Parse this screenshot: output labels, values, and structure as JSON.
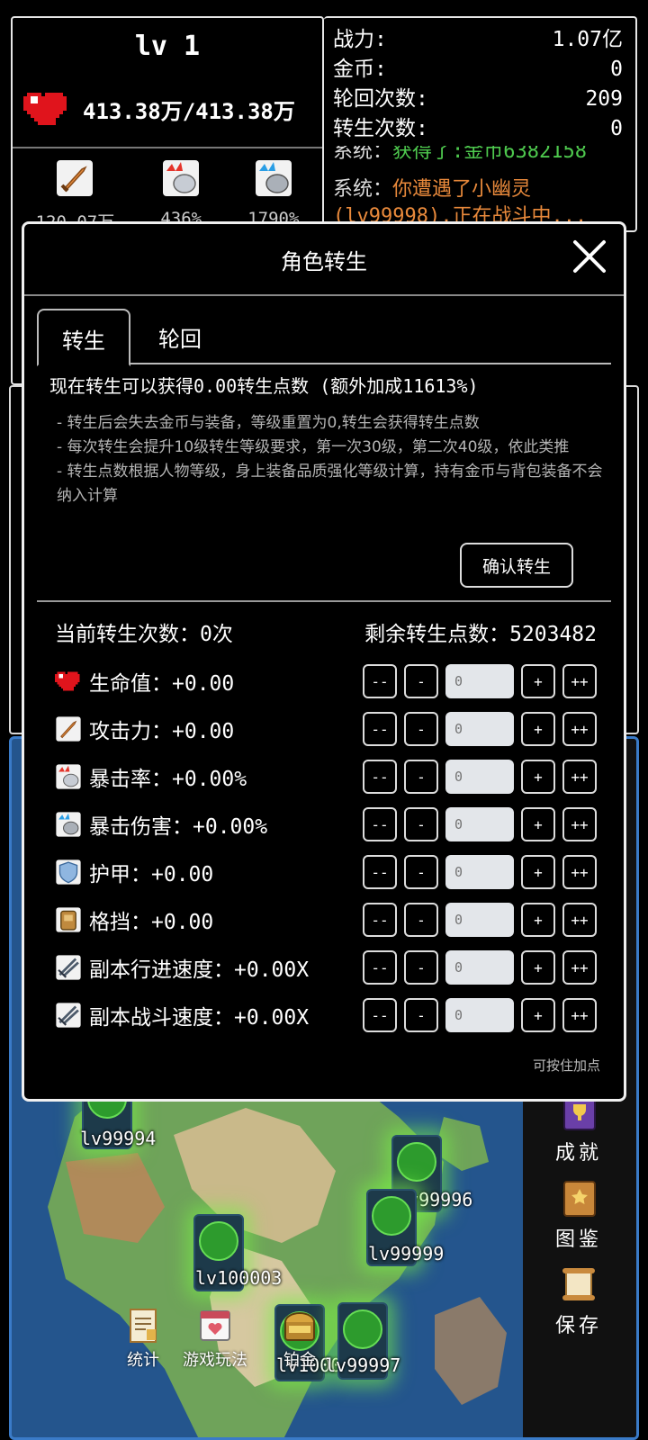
{
  "hud": {
    "level": "lv 1",
    "hp": "413.38万/413.38万",
    "stats": [
      {
        "icon": "sword-icon",
        "value": "120.07万"
      },
      {
        "icon": "crit-rate-icon",
        "value": "436%"
      },
      {
        "icon": "crit-damage-icon",
        "value": "1790%"
      }
    ]
  },
  "resources": [
    {
      "label": "战力:",
      "value": "1.07亿"
    },
    {
      "label": "金币:",
      "value": "0"
    },
    {
      "label": "轮回次数:",
      "value": "209"
    },
    {
      "label": "转生次数:",
      "value": "0"
    }
  ],
  "log": {
    "line1_prefix": "系统：",
    "line1_text": "获得了:金币6382158",
    "line2_prefix": "系统：",
    "line2_text": "你遭遇了小幽灵",
    "line3_text": "(lv99998),正在战斗中..."
  },
  "modal": {
    "title": "角色转生",
    "tabs": [
      "转生",
      "轮回"
    ],
    "gain_text": "现在转生可以获得0.00转生点数 (额外加成11613%)",
    "notes": [
      "- 转生后会失去金币与装备，等级重置为0,转生会获得转生点数",
      "- 每次转生会提升10级转生等级要求，第一次30级，第二次40级，依此类推",
      "- 转生点数根据人物等级，身上装备品质强化等级计算，持有金币与背包装备不会纳入计算"
    ],
    "confirm_label": "确认转生",
    "current_count": "当前转生次数：0次",
    "remaining_points": "剩余转生点数：5203482",
    "controls": {
      "dec_big": "--",
      "dec": "-",
      "inc": "+",
      "inc_big": "++"
    },
    "attributes": [
      {
        "icon": "heart-icon",
        "label": "生命值：+0.00",
        "input": "0"
      },
      {
        "icon": "sword-icon",
        "label": "攻击力：+0.00",
        "input": "0"
      },
      {
        "icon": "crit-rate-icon",
        "label": "暴击率：+0.00%",
        "input": "0"
      },
      {
        "icon": "crit-damage-icon",
        "label": "暴击伤害：+0.00%",
        "input": "0"
      },
      {
        "icon": "shield-icon",
        "label": "护甲：+0.00",
        "input": "0"
      },
      {
        "icon": "block-icon",
        "label": "格挡：+0.00",
        "input": "0"
      },
      {
        "icon": "dungeon-travel-speed-icon",
        "label": "副本行进速度：+0.00X",
        "input": "0"
      },
      {
        "icon": "dungeon-battle-speed-icon",
        "label": "副本战斗速度：+0.00X",
        "input": "0"
      }
    ],
    "hold_hint": "可按住加点"
  },
  "map": {
    "nodes": [
      "lv99994",
      "lv99996",
      "lv99999",
      "lv100003",
      "lv100002",
      "lv99997"
    ],
    "sidebar": [
      {
        "icon": "achievement-book-icon",
        "label": "成就"
      },
      {
        "icon": "codex-book-icon",
        "label": "图鉴"
      },
      {
        "icon": "save-scroll-icon",
        "label": "保存"
      }
    ],
    "bottom": [
      {
        "icon": "statistics-icon",
        "label": "统计"
      },
      {
        "icon": "gameplay-calendar-icon",
        "label": "游戏玩法"
      },
      {
        "icon": "platinum-mvp-chest-icon",
        "label": "铂金"
      }
    ]
  },
  "colors": {
    "log_green": "#4ec94e",
    "log_orange": "#e8893b",
    "map_border": "#3a7bc8",
    "input_bg": "#e3e6ea"
  }
}
